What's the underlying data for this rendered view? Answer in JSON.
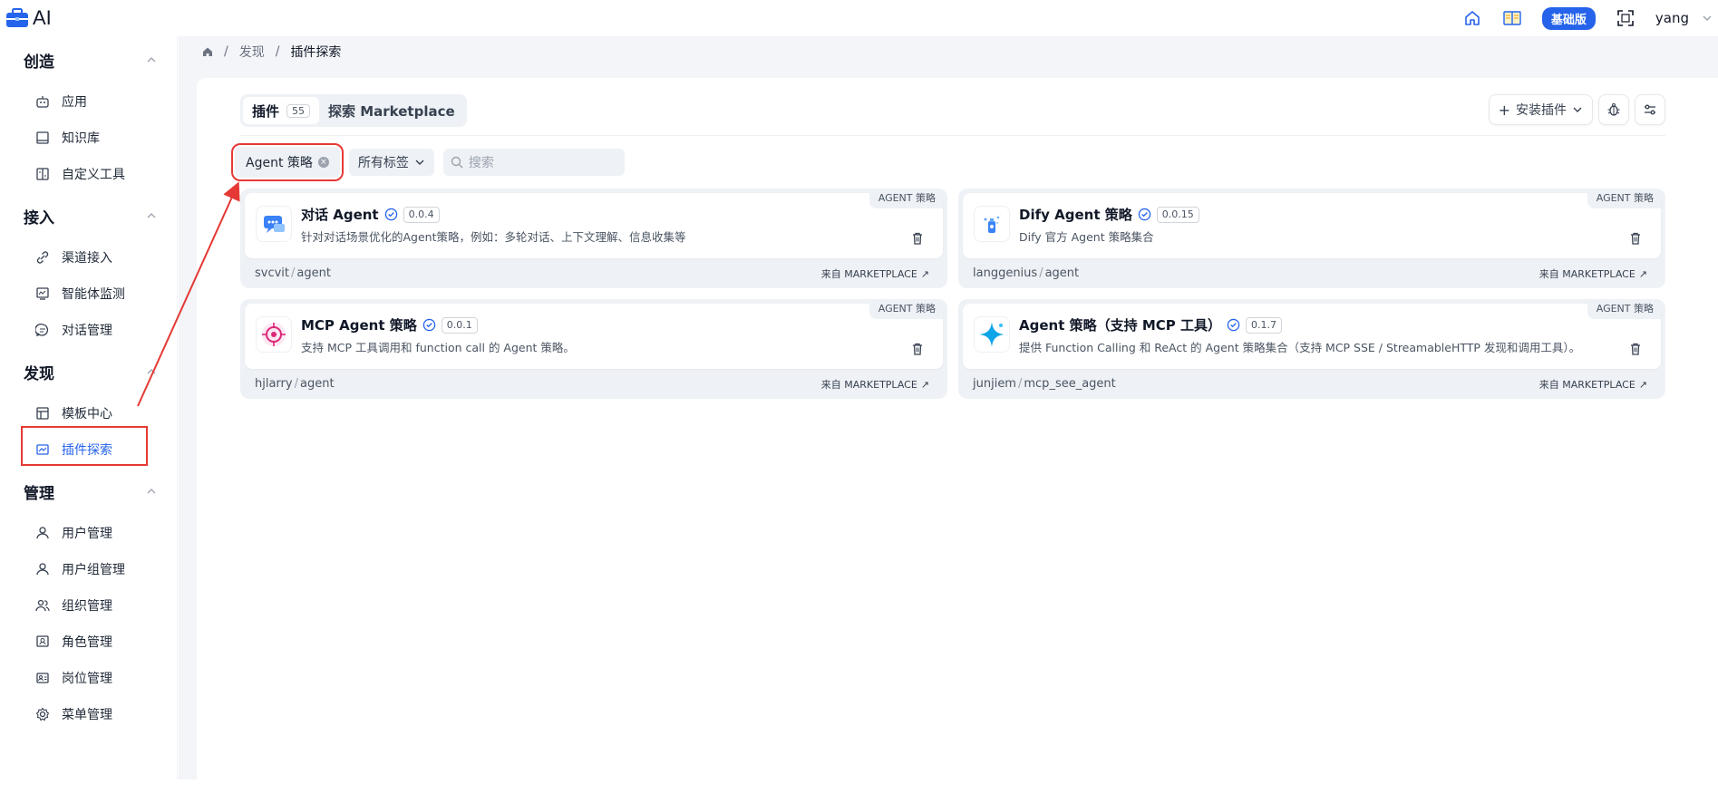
{
  "app": {
    "title": "AI",
    "badge": "基础版",
    "user": "yang"
  },
  "sidebar": {
    "sections": [
      {
        "title": "创造",
        "items": [
          {
            "label": "应用",
            "icon": "robot-icon"
          },
          {
            "label": "知识库",
            "icon": "book-icon"
          },
          {
            "label": "自定义工具",
            "icon": "tool-icon"
          }
        ]
      },
      {
        "title": "接入",
        "items": [
          {
            "label": "渠道接入",
            "icon": "link-icon"
          },
          {
            "label": "智能体监测",
            "icon": "monitor-icon"
          },
          {
            "label": "对话管理",
            "icon": "chat-icon"
          }
        ]
      },
      {
        "title": "发现",
        "items": [
          {
            "label": "模板中心",
            "icon": "template-icon"
          },
          {
            "label": "插件探索",
            "icon": "plugin-icon"
          }
        ]
      },
      {
        "title": "管理",
        "items": [
          {
            "label": "用户管理",
            "icon": "user-icon"
          },
          {
            "label": "用户组管理",
            "icon": "users-icon"
          },
          {
            "label": "组织管理",
            "icon": "org-icon"
          },
          {
            "label": "角色管理",
            "icon": "role-icon"
          },
          {
            "label": "岗位管理",
            "icon": "post-icon"
          },
          {
            "label": "菜单管理",
            "icon": "menu-gear-icon"
          }
        ]
      }
    ]
  },
  "breadcrumb": {
    "items": [
      "发现",
      "插件探索"
    ]
  },
  "tabs": {
    "plugins_label": "插件",
    "plugins_count": "55",
    "explore_label": "探索 Marketplace"
  },
  "actions": {
    "install_label": "安装插件"
  },
  "filters": {
    "active_tag": "Agent 策略",
    "tags_select": "所有标签",
    "search_placeholder": "搜索"
  },
  "cards": [
    {
      "name": "对话 Agent",
      "version": "0.0.4",
      "desc": "针对对话场景优化的Agent策略，例如：多轮对话、上下文理解、信息收集等",
      "tag": "AGENT 策略",
      "author": "svcvit",
      "repo": "agent",
      "source": "来自 MARKETPLACE",
      "logo": "chat-bubble-logo"
    },
    {
      "name": "Dify Agent 策略",
      "version": "0.0.15",
      "desc": "Dify 官方 Agent 策略集合",
      "tag": "AGENT 策略",
      "author": "langgenius",
      "repo": "agent",
      "source": "来自 MARKETPLACE",
      "logo": "dify-logo"
    },
    {
      "name": "MCP Agent 策略",
      "version": "0.0.1",
      "desc": "支持 MCP 工具调用和 function call 的 Agent 策略。",
      "tag": "AGENT 策略",
      "author": "hjlarry",
      "repo": "agent",
      "source": "来自 MARKETPLACE",
      "logo": "target-logo"
    },
    {
      "name": "Agent 策略（支持 MCP 工具）",
      "version": "0.1.7",
      "desc": "提供 Function Calling 和 ReAct 的 Agent 策略集合（支持 MCP SSE / StreamableHTTP 发现和调用工具）。",
      "tag": "AGENT 策略",
      "author": "junjiem",
      "repo": "mcp_see_agent",
      "source": "来自 MARKETPLACE",
      "logo": "sparkle-logo"
    }
  ],
  "colors": {
    "accent": "#2563eb",
    "highlight": "#e53935"
  }
}
